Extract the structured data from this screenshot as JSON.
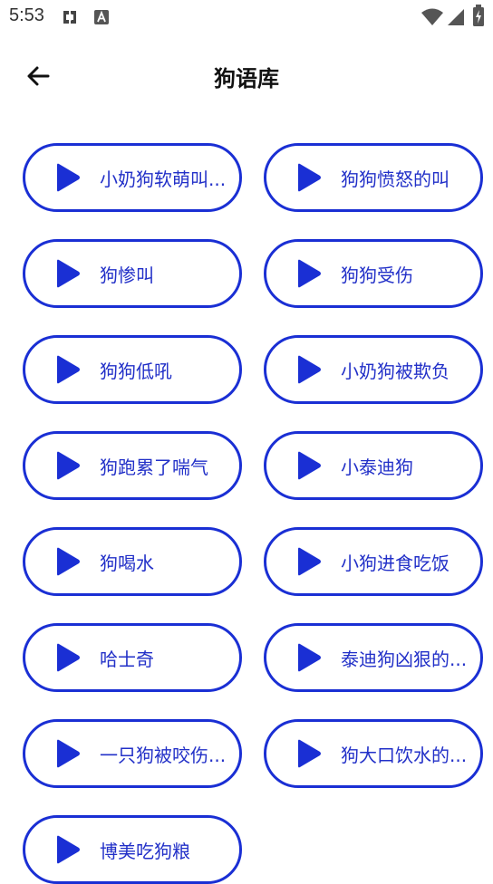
{
  "status_bar": {
    "time": "5:53",
    "icons": [
      "sync-icon",
      "app-notification-icon",
      "wifi-icon",
      "signal-icon",
      "battery-icon"
    ]
  },
  "app_bar": {
    "back_icon": "arrow-left-icon",
    "title": "狗语库"
  },
  "colors": {
    "accent": "#1a2fd4",
    "label": "#2230c8"
  },
  "sounds": [
    {
      "label": "小奶狗软萌叫..."
    },
    {
      "label": "狗狗愤怒的叫"
    },
    {
      "label": "狗惨叫"
    },
    {
      "label": "狗狗受伤"
    },
    {
      "label": "狗狗低吼"
    },
    {
      "label": "小奶狗被欺负"
    },
    {
      "label": "狗跑累了喘气"
    },
    {
      "label": "小泰迪狗"
    },
    {
      "label": "狗喝水"
    },
    {
      "label": "小狗进食吃饭"
    },
    {
      "label": "哈士奇"
    },
    {
      "label": "泰迪狗凶狠的..."
    },
    {
      "label": "一只狗被咬伤..."
    },
    {
      "label": "狗大口饮水的..."
    },
    {
      "label": "博美吃狗粮"
    }
  ]
}
